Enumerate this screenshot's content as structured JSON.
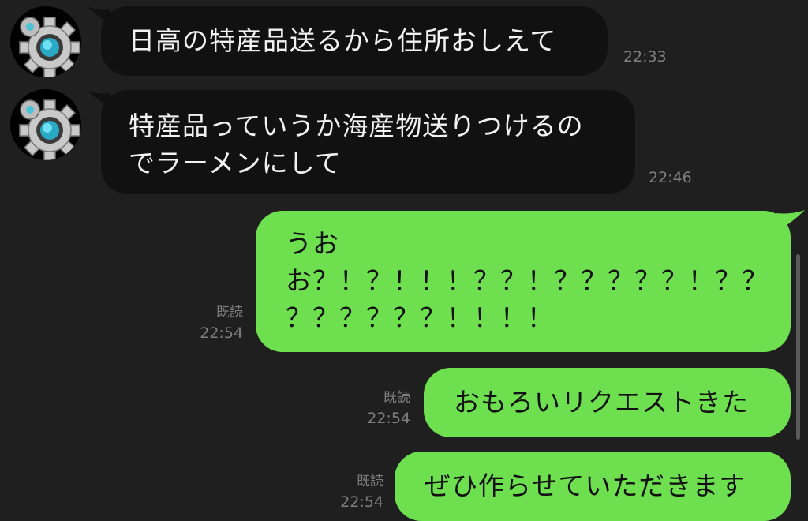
{
  "messages": [
    {
      "sender": "friend",
      "avatar_icon": "gear-gem-icon",
      "text": "日高の特産品送るから住所おしえて",
      "time": "22:33"
    },
    {
      "sender": "friend",
      "avatar_icon": "gear-gem-icon",
      "text": "特産品っていうか海産物送りつけるの\nでラーメンにして",
      "time": "22:46"
    },
    {
      "sender": "me",
      "text": "うお\nお？！？！！！？？！？？？？？！？？\n？？？？？？！！！！",
      "read": "既読",
      "time": "22:54"
    },
    {
      "sender": "me",
      "text": "おもろいリクエストきた",
      "read": "既読",
      "time": "22:54"
    },
    {
      "sender": "me",
      "text": "ぜひ作らせていただきます",
      "read": "既読",
      "time": "22:54"
    }
  ],
  "colors": {
    "background": "#1f1f1f",
    "received_bubble": "#111111",
    "sent_bubble": "#6ee04f",
    "meta_text": "#7f7f7f"
  }
}
